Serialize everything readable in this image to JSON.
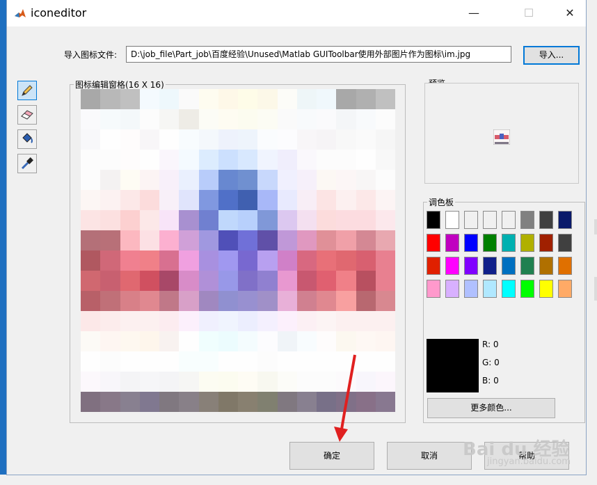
{
  "window": {
    "title": "iconeditor"
  },
  "title_buttons": {
    "minimize": "—",
    "maximize": "☐",
    "close": "✕"
  },
  "import_row": {
    "label": "导入图标文件:",
    "path_value": "D:\\job_file\\Part_job\\百度经验\\Unused\\Matlab GUIToolbar使用外部图片作为图标\\im.jpg",
    "import_button": "导入..."
  },
  "tools": [
    {
      "name": "pencil-icon",
      "active": true
    },
    {
      "name": "eraser-icon",
      "active": false
    },
    {
      "name": "paint-bucket-icon",
      "active": false
    },
    {
      "name": "eyedropper-icon",
      "active": false
    }
  ],
  "editor": {
    "title": "图标编辑窗格(16 X 16)"
  },
  "preview": {
    "title": "预览"
  },
  "palette": {
    "title": "调色板",
    "colors": [
      "#000000",
      "#ffffff",
      "#f0f0f0",
      "#f0f0f0",
      "#f0f0f0",
      "#808080",
      "#404040",
      "#0a1a6a",
      "#ff0000",
      "#c000c0",
      "#0000ff",
      "#008000",
      "#00b0b0",
      "#b0b000",
      "#a02000",
      "#404040",
      "#e02000",
      "#ff00ff",
      "#8000ff",
      "#10208a",
      "#0070c0",
      "#208050",
      "#b07000",
      "#e07000",
      "#ff99cc",
      "#d8b0ff",
      "#b0c0ff",
      "#b0e8ff",
      "#00ffff",
      "#00ff00",
      "#ffff00",
      "#ffaa66"
    ],
    "more_colors_button": "更多颜色...",
    "r_label": "R: 0",
    "g_label": "G: 0",
    "b_label": "B: 0",
    "selected_color": "#000000"
  },
  "buttons": {
    "ok": "确定",
    "cancel": "取消",
    "help": "帮助"
  },
  "watermark": {
    "text": "Bai du 经验",
    "sub": "jingyan.baidu.com"
  },
  "pixels": [
    [
      "#a8a8a8",
      "#b8b8b8",
      "#c0c0c0",
      "#f4fafe",
      "#eef8fc",
      "#fafafa",
      "#fefcf0",
      "#fef8e8",
      "#fefce8",
      "#fcf8e8",
      "#fcfcf8",
      "#eef6f8",
      "#f0f8fc",
      "#a8a8a8",
      "#b0b0b0",
      "#c0c0c0"
    ],
    [
      "#fafafc",
      "#f6fafc",
      "#f4f8fa",
      "#fcfcfc",
      "#f6f6f4",
      "#eeece6",
      "#fcfcf6",
      "#fefcf2",
      "#fcfcf0",
      "#fcfcf4",
      "#fafafa",
      "#f8fafc",
      "#fafafc",
      "#f4f6f8",
      "#f8fafc",
      "#fcfcfc"
    ],
    [
      "#f8f8fa",
      "#fefefe",
      "#fefcfc",
      "#f8f6f8",
      "#fefefe",
      "#f8fcfe",
      "#f4f8fc",
      "#eef2fc",
      "#eef4fc",
      "#fafcfe",
      "#fcfcfe",
      "#f8f6f8",
      "#f6f4f6",
      "#f8f8f8",
      "#fafafa",
      "#f6f6f6"
    ],
    [
      "#fcfcfc",
      "#fcfcfc",
      "#fefcfc",
      "#fefefe",
      "#faf6fc",
      "#f4faff",
      "#dcecfe",
      "#cce0fe",
      "#d8e8fe",
      "#f0f4fe",
      "#f0eefc",
      "#faf8fc",
      "#fcfcfc",
      "#fcfcfc",
      "#fefefe",
      "#f8f8f8"
    ],
    [
      "#fcfcfc",
      "#f4f2f2",
      "#fefcf4",
      "#fcf4f4",
      "#f8f0fa",
      "#eaf0fe",
      "#b8ccfa",
      "#6888d0",
      "#7090d0",
      "#c8d8fc",
      "#f0f0fe",
      "#f6f0fa",
      "#fcf8f4",
      "#fcf6f6",
      "#f8f6f6",
      "#fcfcfc"
    ],
    [
      "#fcf6f4",
      "#fcf2f2",
      "#fce8e8",
      "#fcdcdc",
      "#f8f0f8",
      "#e0e4fc",
      "#8098e0",
      "#5070c8",
      "#4060b0",
      "#a8b8f8",
      "#e8eafe",
      "#f8eef6",
      "#fce4e4",
      "#fcf0f0",
      "#fce8e8",
      "#fcf4f4"
    ],
    [
      "#fce4e4",
      "#fce0e0",
      "#fcd0d0",
      "#fce8e8",
      "#f8e4f8",
      "#a890d0",
      "#7080d0",
      "#c0d8fc",
      "#b8d0fc",
      "#8098d8",
      "#dcc8f0",
      "#f4e0f0",
      "#fcdcdc",
      "#fcdce0",
      "#fcdce0",
      "#fce8ec"
    ],
    [
      "#b47078",
      "#b87078",
      "#fcb8c0",
      "#fce0e4",
      "#fcb0d0",
      "#d0a0d8",
      "#a098e0",
      "#5050b8",
      "#7070d8",
      "#6050a8",
      "#c098d8",
      "#e098c0",
      "#e09098",
      "#f0a0a8",
      "#d48894",
      "#e8a8b0"
    ],
    [
      "#b05860",
      "#d06878",
      "#f08090",
      "#f08088",
      "#d87090",
      "#f0a0e0",
      "#a890e0",
      "#a098f0",
      "#7868d0",
      "#b8a0f0",
      "#d080c8",
      "#d86880",
      "#e87078",
      "#e06870",
      "#d86070",
      "#e88090"
    ],
    [
      "#d06870",
      "#c86070",
      "#e06870",
      "#d05060",
      "#a84868",
      "#d88cc8",
      "#b090d8",
      "#9898e8",
      "#8070c8",
      "#9080d0",
      "#e898d0",
      "#c85870",
      "#e06070",
      "#f08088",
      "#b85060",
      "#e88090"
    ],
    [
      "#b86068",
      "#c07078",
      "#d88088",
      "#e08890",
      "#c07888",
      "#d8a0c8",
      "#a088c0",
      "#9090d0",
      "#9890d0",
      "#a090c8",
      "#e8b0d8",
      "#d08090",
      "#e08890",
      "#f8a0a0",
      "#b86870",
      "#d88890"
    ],
    [
      "#fce8e8",
      "#fcecec",
      "#fcf0f0",
      "#fcf0f0",
      "#fcecf0",
      "#fcf0fc",
      "#f0f0fe",
      "#f0f4fe",
      "#eceefe",
      "#f4f0fe",
      "#fcf0fc",
      "#fcf0f4",
      "#fcf4f4",
      "#fcf0f0",
      "#fcf0f0",
      "#fcf0f0"
    ],
    [
      "#fcfaf6",
      "#fef6f2",
      "#fef8f0",
      "#fef6ec",
      "#f8f2f0",
      "#fefefe",
      "#f0fefe",
      "#ecfcfe",
      "#f4fcfe",
      "#fcfcfe",
      "#f0f4f8",
      "#f8fcfe",
      "#fefcfc",
      "#fcf8f0",
      "#fef8f4",
      "#fef6f2"
    ],
    [
      "#fefefe",
      "#fcfcfc",
      "#fefefe",
      "#fefefe",
      "#fefefe",
      "#f8fefe",
      "#f8fefe",
      "#fefefe",
      "#fefefe",
      "#fcfcfc",
      "#fefefe",
      "#fefefe",
      "#fefefe",
      "#fefefe",
      "#fefefe",
      "#fefefe"
    ],
    [
      "#fcf8fc",
      "#f8f6fa",
      "#f4f4f6",
      "#f6f6f8",
      "#f4f4f6",
      "#f6f6f4",
      "#fcfcf2",
      "#fcfcf0",
      "#fefcf4",
      "#f8f8f0",
      "#fcfcf8",
      "#fcfcfc",
      "#fcfcfc",
      "#fcfafc",
      "#f8f6fc",
      "#fcf6fc"
    ],
    [
      "#807080",
      "#887888",
      "#888090",
      "#807890",
      "#807880",
      "#888088",
      "#888078",
      "#807868",
      "#888070",
      "#808070",
      "#807880",
      "#888090",
      "#787088",
      "#807088",
      "#887088",
      "#887890"
    ]
  ]
}
